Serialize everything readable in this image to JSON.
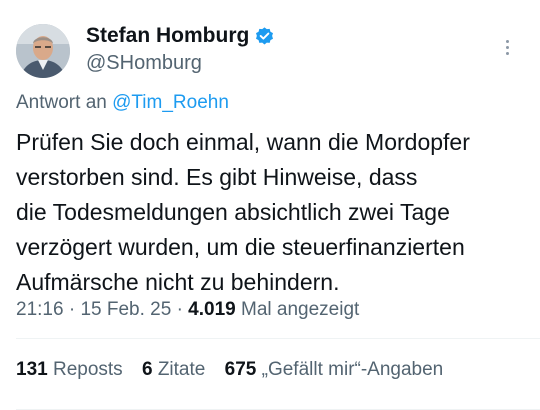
{
  "author": {
    "display_name": "Stefan Homburg",
    "handle": "@SHomburg",
    "verified": true,
    "verified_color": "#1d9bf0"
  },
  "reply": {
    "prefix": "Antwort an",
    "mention": "@Tim_Roehn"
  },
  "tweet": {
    "lines": [
      "Prüfen Sie doch einmal, wann die Mordopfer",
      "verstorben sind. Es gibt Hinweise, dass",
      "die Todesmeldungen absichtlich zwei Tage",
      "verzögert wurden, um die steuerfinanzierten",
      "Aufmärsche nicht zu behindern."
    ]
  },
  "meta": {
    "time": "21:16",
    "separator": "·",
    "date": "15 Feb. 25",
    "views_count": "4.019",
    "views_label": "Mal angezeigt"
  },
  "stats": {
    "reposts_count": "131",
    "reposts_label": "Reposts",
    "quotes_count": "6",
    "quotes_label": "Zitate",
    "likes_count": "675",
    "likes_label": "„Gefällt mir“-Angaben"
  },
  "colors": {
    "text": "#0f1419",
    "secondary": "#536471",
    "link": "#1d9bf0",
    "divider": "#eff3f4"
  },
  "icons": {
    "verified": "verified-badge-icon",
    "more": "more-options-icon"
  }
}
